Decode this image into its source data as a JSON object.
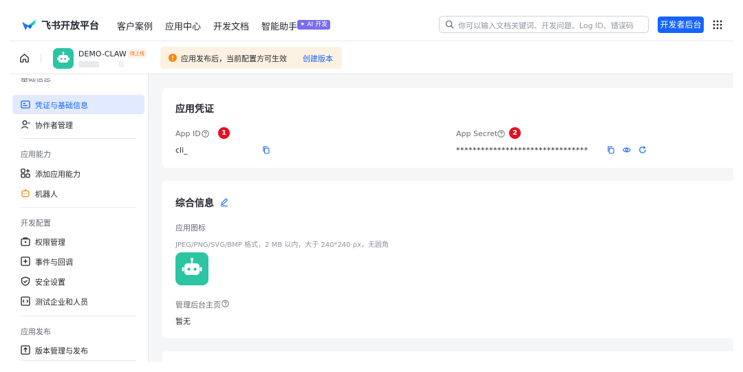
{
  "topnav": {
    "brand": "飞书开放平台",
    "links": [
      "客户案例",
      "应用中心",
      "开发文档",
      "智能助手"
    ],
    "ai_badge": "✦ AI 开发",
    "search_placeholder": "你可以输入文档关键词、开发问题、Log ID、错误码",
    "dev_button": "开发者后台"
  },
  "subhead": {
    "app_name": "DEMO-CLAW",
    "status": "待上线",
    "notice_text": "应用发布后，当前配置方可生效",
    "notice_link": "创建版本"
  },
  "sidebar": {
    "partial_top": "基础信息",
    "items_group1": [
      "凭证与基础信息",
      "协作者管理"
    ],
    "group2_title": "应用能力",
    "items_group2": [
      "添加应用能力",
      "机器人"
    ],
    "group3_title": "开发配置",
    "items_group3": [
      "权限管理",
      "事件与回调",
      "安全设置",
      "测试企业和人员"
    ],
    "group4_title": "应用发布",
    "items_group4": [
      "版本管理与发布"
    ]
  },
  "credentials": {
    "title": "应用凭证",
    "app_id_label": "App ID",
    "app_id_value": "cli_",
    "app_id_badge": "1",
    "secret_label": "App Secret",
    "secret_value": "********************************",
    "secret_badge": "2"
  },
  "general": {
    "title": "综合信息",
    "icon_label": "应用图标",
    "icon_hint": "JPEG/PNG/SVG/BMP 格式，2 MB 以内，大于 240*240 px，无圆角",
    "admin_home_label": "管理后台主页",
    "admin_home_value": "暂无"
  },
  "colors": {
    "accent": "#1664ff",
    "brand_teal": "#2cc5a3",
    "badge_red": "#e3101f",
    "warning": "#ed6d0c"
  }
}
